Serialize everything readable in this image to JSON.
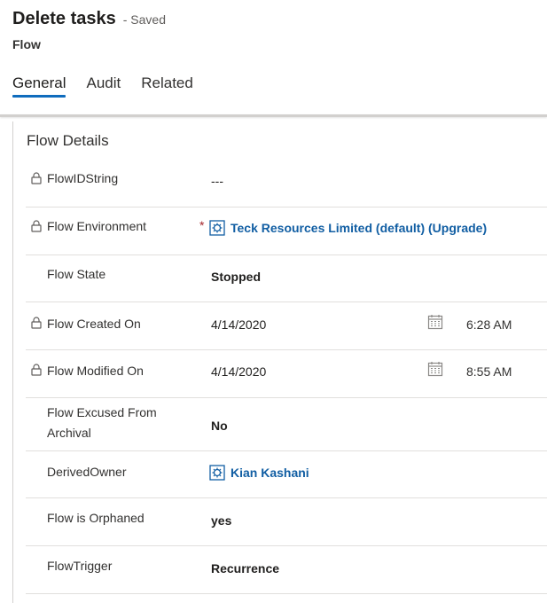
{
  "header": {
    "title": "Delete tasks",
    "saved_status": "- Saved",
    "entity": "Flow"
  },
  "tabs": [
    {
      "label": "General",
      "active": true
    },
    {
      "label": "Audit",
      "active": false
    },
    {
      "label": "Related",
      "active": false
    }
  ],
  "section": {
    "title": "Flow Details",
    "fields": {
      "flow_id": {
        "label": "FlowIDString",
        "value": "---",
        "locked": true
      },
      "environment": {
        "label": "Flow Environment",
        "required": "*",
        "value": "Teck Resources Limited (default) (Upgrade)",
        "locked": true
      },
      "state": {
        "label": "Flow State",
        "value": "Stopped"
      },
      "created_on": {
        "label": "Flow Created On",
        "date": "4/14/2020",
        "time": "6:28 AM",
        "locked": true
      },
      "modified_on": {
        "label": "Flow Modified On",
        "date": "4/14/2020",
        "time": "8:55 AM",
        "locked": true
      },
      "excused": {
        "label_line1": "Flow Excused From",
        "label_line2": "Archival",
        "value": "No"
      },
      "owner": {
        "label": "DerivedOwner",
        "value": "Kian Kashani"
      },
      "orphaned": {
        "label": "Flow is Orphaned",
        "value": "yes"
      },
      "trigger": {
        "label": "FlowTrigger",
        "value": "Recurrence"
      }
    }
  },
  "colors": {
    "accent": "#0f6cbd",
    "link": "#115ea3",
    "required": "#a4262c"
  }
}
